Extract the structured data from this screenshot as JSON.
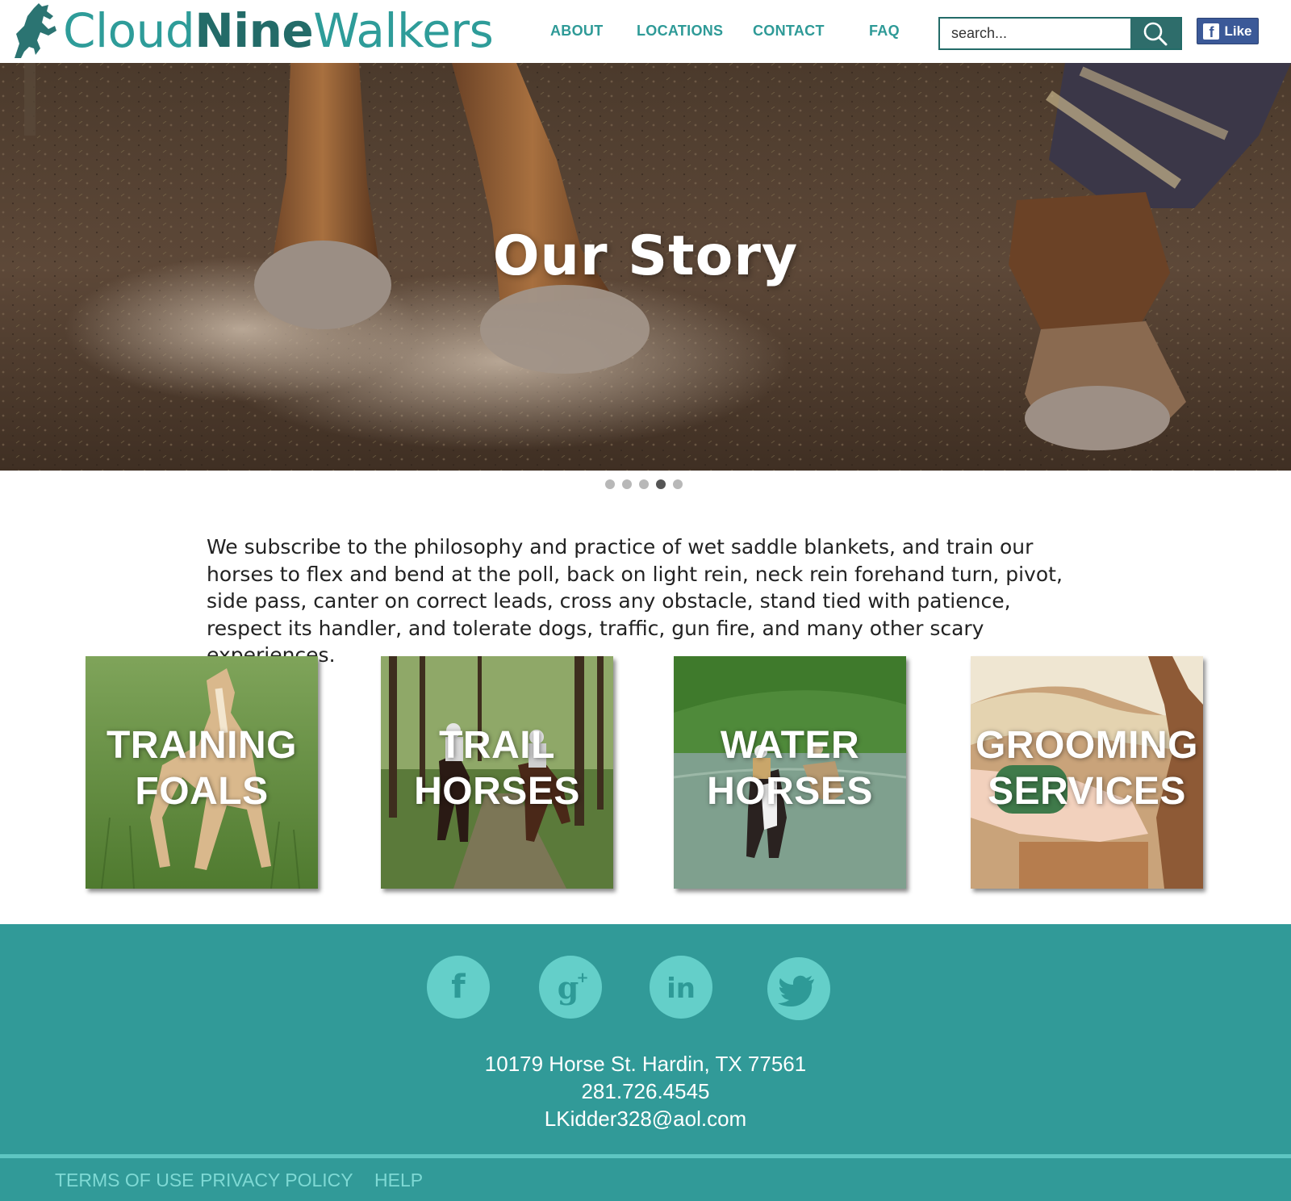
{
  "header": {
    "logo": {
      "part1": "Cloud",
      "part2": "Nine",
      "part3": "Walkers",
      "icon": "rearing-horse-logo"
    },
    "nav": [
      "ABOUT",
      "LOCATIONS",
      "CONTACT",
      "FAQ"
    ],
    "search": {
      "placeholder": "search...",
      "icon": "search-icon"
    },
    "facebook_like": {
      "label": "Like",
      "icon": "facebook-icon"
    }
  },
  "hero": {
    "title": "Our Story",
    "slider": {
      "total_slides": 5,
      "active_slide": 4
    }
  },
  "intro": {
    "text": "We subscribe to the philosophy and practice of wet saddle blankets, and train our horses to flex and bend at the poll, back on light rein, neck rein forehand turn, pivot, side pass, canter on correct leads, cross any obstacle, stand tied with patience, respect its handler, and tolerate dogs, traffic, gun fire, and many other scary experiences."
  },
  "services": [
    {
      "line1": "TRAINING",
      "line2": "FOALS",
      "image": "foal-in-meadow"
    },
    {
      "line1": "TRAIL",
      "line2": "HORSES",
      "image": "riders-on-forest-trail"
    },
    {
      "line1": "WATER",
      "line2": "HORSES",
      "image": "horses-crossing-river"
    },
    {
      "line1": "GROOMING",
      "line2": "SERVICES",
      "image": "hand-brushing-horse"
    }
  ],
  "footer": {
    "social": [
      "facebook-icon",
      "google-plus-icon",
      "linkedin-icon",
      "twitter-icon"
    ],
    "address": "10179 Horse St. Hardin, TX 77561",
    "phone": "281.726.4545",
    "email": "LKidder328@aol.com",
    "links": [
      "TERMS OF USE",
      "PRIVACY POLICY",
      "HELP"
    ]
  },
  "colors": {
    "brand_teal": "#319a98",
    "brand_dark_teal": "#236b68",
    "social_circle": "#64cfc9",
    "footer_link": "#7ed9d4",
    "facebook_blue": "#3b5998"
  }
}
